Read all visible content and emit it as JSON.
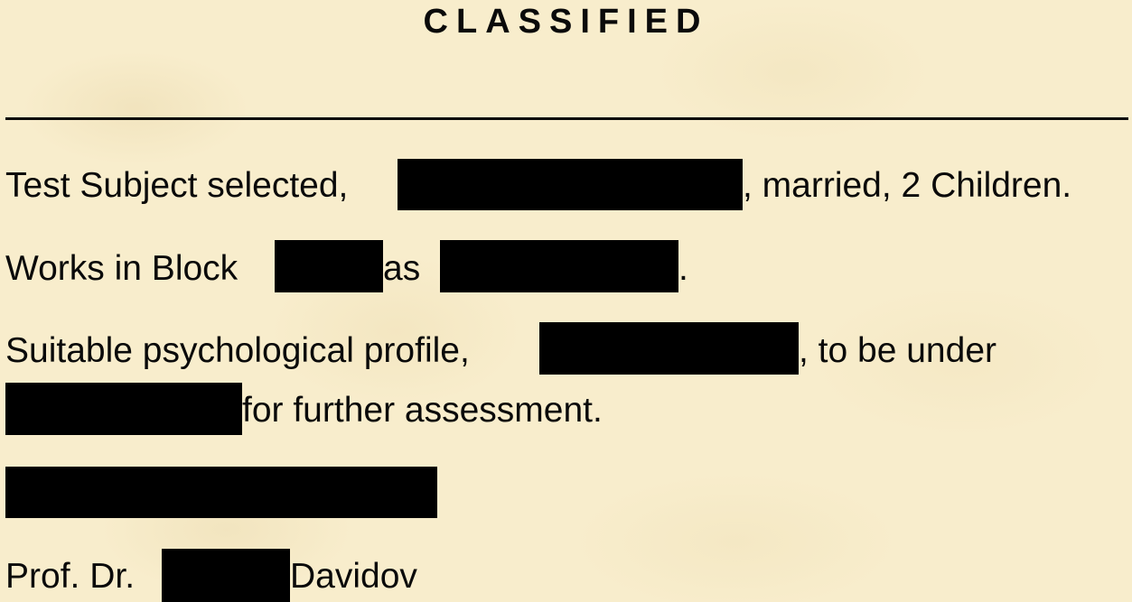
{
  "document": {
    "title": "CLASSIFIED",
    "line1": {
      "before": "Test Subject selected, ",
      "after": ", married, 2 Children."
    },
    "line2": {
      "before": "Works in Block ",
      "middle": " as ",
      "after": "."
    },
    "line3": {
      "before": "Suitable psychological profile, ",
      "after": ", to be under"
    },
    "line4": {
      "after": " for further assessment."
    },
    "signature": {
      "before": "Prof. Dr. ",
      "after": " Davidov"
    }
  }
}
